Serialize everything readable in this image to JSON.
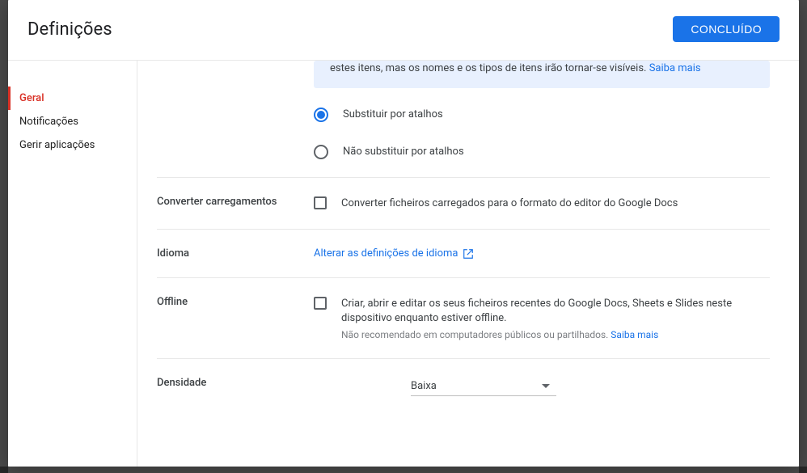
{
  "header": {
    "title": "Definições",
    "done_label": "CONCLUÍDO"
  },
  "sidebar": {
    "items": [
      {
        "label": "Geral",
        "selected": true
      },
      {
        "label": "Notificações",
        "selected": false
      },
      {
        "label": "Gerir aplicações",
        "selected": false
      }
    ]
  },
  "shortcuts": {
    "banner_prefix": "estes itens, mas os nomes e os tipos de itens irão tornar-se visíveis. ",
    "banner_link": "Saiba mais",
    "option_replace": "Substituir por atalhos",
    "option_no_replace": "Não substituir por atalhos",
    "selected": "replace"
  },
  "convert": {
    "label": "Converter carregamentos",
    "checkbox_label": "Converter ficheiros carregados para o formato do editor do Google Docs",
    "checked": false
  },
  "language": {
    "label": "Idioma",
    "link_text": "Alterar as definições de idioma"
  },
  "offline": {
    "label": "Offline",
    "checkbox_label": "Criar, abrir e editar os seus ficheiros recentes do Google Docs, Sheets e Slides neste dispositivo enquanto estiver offline.",
    "sub_text": "Não recomendado em computadores públicos ou partilhados. ",
    "sub_link": "Saiba mais",
    "checked": false
  },
  "density": {
    "label": "Densidade",
    "value": "Baixa"
  }
}
